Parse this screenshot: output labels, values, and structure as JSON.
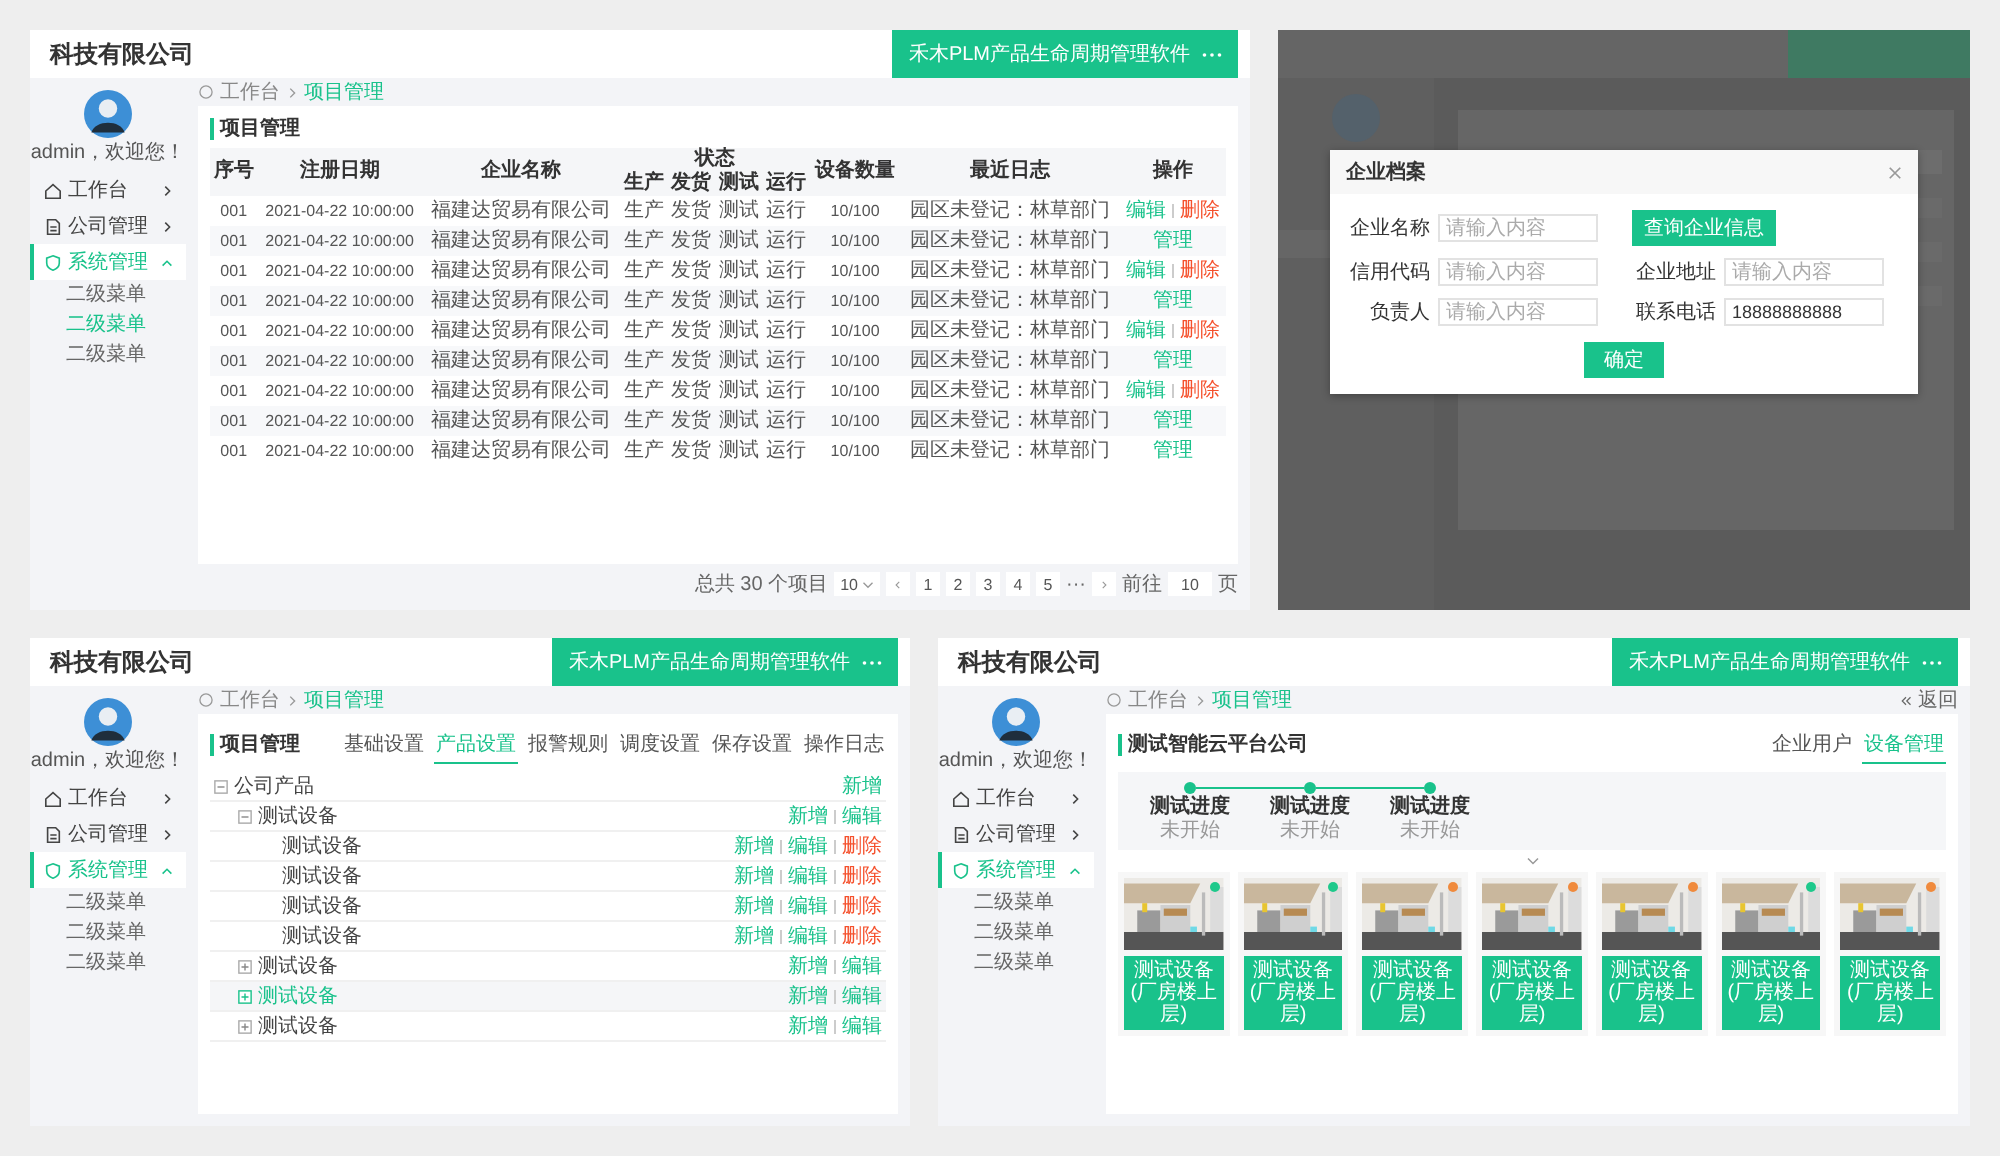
{
  "screens": [
    {
      "kind": "table",
      "app_title": "科技有限公司",
      "product_button": "禾木PLM产品生命周期管理软件",
      "sidebar": {
        "user": "admin，欢迎您！",
        "items": [
          {
            "label": "工作台",
            "selected": false,
            "expanded": false
          },
          {
            "label": "公司管理",
            "selected": false,
            "expanded": false
          },
          {
            "label": "系统管理",
            "selected": true,
            "expanded": true,
            "children": [
              {
                "label": "二级菜单",
                "selected": false
              },
              {
                "label": "二级菜单",
                "selected": true
              },
              {
                "label": "二级菜单",
                "selected": false
              }
            ]
          }
        ]
      },
      "breadcrumb": [
        "工作台",
        "项目管理"
      ],
      "card_title": "项目管理",
      "table": {
        "group_label": "状态",
        "columns": [
          {
            "label": "序号",
            "grouped": false
          },
          {
            "label": "注册日期",
            "grouped": false
          },
          {
            "label": "企业名称",
            "grouped": false
          },
          {
            "label": "生产",
            "grouped": true
          },
          {
            "label": "发货",
            "grouped": true
          },
          {
            "label": "测试",
            "grouped": true
          },
          {
            "label": "运行",
            "grouped": true
          },
          {
            "label": "设备数量",
            "grouped": false
          },
          {
            "label": "最近日志",
            "grouped": false
          },
          {
            "label": "操作",
            "grouped": false
          }
        ],
        "rows": [
          {
            "cells": [
              "001",
              "2021-04-22 10:00:00",
              "福建达贸易有限公司",
              "生产",
              "发货",
              "测试",
              "运行",
              "10/100",
              "园区未登记：林草部门"
            ],
            "actions": [
              {
                "label": "编辑",
                "danger": false
              },
              {
                "label": "删除",
                "danger": true
              }
            ]
          },
          {
            "cells": [
              "001",
              "2021-04-22 10:00:00",
              "福建达贸易有限公司",
              "生产",
              "发货",
              "测试",
              "运行",
              "10/100",
              "园区未登记：林草部门"
            ],
            "actions": [
              {
                "label": "管理",
                "danger": false
              }
            ]
          },
          {
            "cells": [
              "001",
              "2021-04-22 10:00:00",
              "福建达贸易有限公司",
              "生产",
              "发货",
              "测试",
              "运行",
              "10/100",
              "园区未登记：林草部门"
            ],
            "actions": [
              {
                "label": "编辑",
                "danger": false
              },
              {
                "label": "删除",
                "danger": true
              }
            ]
          },
          {
            "cells": [
              "001",
              "2021-04-22 10:00:00",
              "福建达贸易有限公司",
              "生产",
              "发货",
              "测试",
              "运行",
              "10/100",
              "园区未登记：林草部门"
            ],
            "actions": [
              {
                "label": "管理",
                "danger": false
              }
            ]
          },
          {
            "cells": [
              "001",
              "2021-04-22 10:00:00",
              "福建达贸易有限公司",
              "生产",
              "发货",
              "测试",
              "运行",
              "10/100",
              "园区未登记：林草部门"
            ],
            "actions": [
              {
                "label": "编辑",
                "danger": false
              },
              {
                "label": "删除",
                "danger": true
              }
            ]
          },
          {
            "cells": [
              "001",
              "2021-04-22 10:00:00",
              "福建达贸易有限公司",
              "生产",
              "发货",
              "测试",
              "运行",
              "10/100",
              "园区未登记：林草部门"
            ],
            "actions": [
              {
                "label": "管理",
                "danger": false
              }
            ]
          },
          {
            "cells": [
              "001",
              "2021-04-22 10:00:00",
              "福建达贸易有限公司",
              "生产",
              "发货",
              "测试",
              "运行",
              "10/100",
              "园区未登记：林草部门"
            ],
            "actions": [
              {
                "label": "编辑",
                "danger": false
              },
              {
                "label": "删除",
                "danger": true
              }
            ]
          },
          {
            "cells": [
              "001",
              "2021-04-22 10:00:00",
              "福建达贸易有限公司",
              "生产",
              "发货",
              "测试",
              "运行",
              "10/100",
              "园区未登记：林草部门"
            ],
            "actions": [
              {
                "label": "管理",
                "danger": false
              }
            ]
          },
          {
            "cells": [
              "001",
              "2021-04-22 10:00:00",
              "福建达贸易有限公司",
              "生产",
              "发货",
              "测试",
              "运行",
              "10/100",
              "园区未登记：林草部门"
            ],
            "actions": [
              {
                "label": "管理",
                "danger": false
              }
            ]
          }
        ]
      },
      "pagination": {
        "total": "总共 30 个项目",
        "page_size": "10",
        "pages": [
          "1",
          "2",
          "3",
          "4",
          "5"
        ],
        "ellipsis": "···",
        "goto_label": "前往",
        "goto_value": "10",
        "goto_suffix": "页"
      }
    },
    {
      "kind": "modal",
      "modal": {
        "title": "企业档案",
        "rows": [
          [
            {
              "kind": "field",
              "label": "企业名称",
              "placeholder": "请输入内容"
            },
            {
              "kind": "button",
              "label": "查询企业信息"
            }
          ],
          [
            {
              "kind": "field",
              "label": "信用代码",
              "placeholder": "请输入内容"
            },
            {
              "kind": "field",
              "label": "企业地址",
              "placeholder": "请输入内容"
            }
          ],
          [
            {
              "kind": "field",
              "label": "负责人",
              "placeholder": "请输入内容"
            },
            {
              "kind": "field",
              "label": "联系电话",
              "value": "18888888888"
            }
          ]
        ],
        "confirm": "确定"
      }
    },
    {
      "kind": "tree",
      "app_title": "科技有限公司",
      "product_button": "禾木PLM产品生命周期管理软件",
      "sidebar": {
        "user": "admin，欢迎您！",
        "items": [
          {
            "label": "工作台",
            "selected": false,
            "expanded": false
          },
          {
            "label": "公司管理",
            "selected": false,
            "expanded": false
          },
          {
            "label": "系统管理",
            "selected": true,
            "expanded": true,
            "children": [
              {
                "label": "二级菜单",
                "selected": false
              },
              {
                "label": "二级菜单",
                "selected": false
              },
              {
                "label": "二级菜单",
                "selected": false
              }
            ]
          }
        ]
      },
      "breadcrumb": [
        "工作台",
        "项目管理"
      ],
      "card_title": "项目管理",
      "tabs": [
        {
          "label": "基础设置",
          "selected": false
        },
        {
          "label": "产品设置",
          "selected": true
        },
        {
          "label": "报警规则",
          "selected": false
        },
        {
          "label": "调度设置",
          "selected": false
        },
        {
          "label": "保存设置",
          "selected": false
        },
        {
          "label": "操作日志",
          "selected": false
        }
      ],
      "tree": [
        {
          "label": "公司产品",
          "expanded": true,
          "selected": false,
          "actions": [
            {
              "label": "新增",
              "danger": false
            }
          ],
          "children": [
            {
              "label": "测试设备",
              "expanded": true,
              "selected": false,
              "actions": [
                {
                  "label": "新增",
                  "danger": false
                },
                {
                  "label": "编辑",
                  "danger": false
                }
              ],
              "children": [
                {
                  "label": "测试设备",
                  "selected": false,
                  "actions": [
                    {
                      "label": "新增",
                      "danger": false
                    },
                    {
                      "label": "编辑",
                      "danger": false
                    },
                    {
                      "label": "删除",
                      "danger": true
                    }
                  ]
                },
                {
                  "label": "测试设备",
                  "selected": false,
                  "actions": [
                    {
                      "label": "新增",
                      "danger": false
                    },
                    {
                      "label": "编辑",
                      "danger": false
                    },
                    {
                      "label": "删除",
                      "danger": true
                    }
                  ]
                },
                {
                  "label": "测试设备",
                  "selected": false,
                  "actions": [
                    {
                      "label": "新增",
                      "danger": false
                    },
                    {
                      "label": "编辑",
                      "danger": false
                    },
                    {
                      "label": "删除",
                      "danger": true
                    }
                  ]
                },
                {
                  "label": "测试设备",
                  "selected": false,
                  "actions": [
                    {
                      "label": "新增",
                      "danger": false
                    },
                    {
                      "label": "编辑",
                      "danger": false
                    },
                    {
                      "label": "删除",
                      "danger": true
                    }
                  ]
                }
              ]
            },
            {
              "label": "测试设备",
              "expanded": false,
              "selected": false,
              "actions": [
                {
                  "label": "新增",
                  "danger": false
                },
                {
                  "label": "编辑",
                  "danger": false
                }
              ]
            },
            {
              "label": "测试设备",
              "expanded": false,
              "selected": true,
              "actions": [
                {
                  "label": "新增",
                  "danger": false
                },
                {
                  "label": "编辑",
                  "danger": false
                }
              ]
            },
            {
              "label": "测试设备",
              "expanded": false,
              "selected": false,
              "actions": [
                {
                  "label": "新增",
                  "danger": false
                },
                {
                  "label": "编辑",
                  "danger": false
                }
              ]
            }
          ]
        }
      ]
    },
    {
      "kind": "cards",
      "app_title": "科技有限公司",
      "product_button": "禾木PLM产品生命周期管理软件",
      "sidebar": {
        "user": "admin，欢迎您！",
        "items": [
          {
            "label": "工作台",
            "selected": false,
            "expanded": false
          },
          {
            "label": "公司管理",
            "selected": false,
            "expanded": false
          },
          {
            "label": "系统管理",
            "selected": true,
            "expanded": true,
            "children": [
              {
                "label": "二级菜单",
                "selected": false
              },
              {
                "label": "二级菜单",
                "selected": false
              },
              {
                "label": "二级菜单",
                "selected": false
              }
            ]
          }
        ]
      },
      "breadcrumb": [
        "工作台",
        "项目管理"
      ],
      "back": "返回",
      "card_title": "测试智能云平台公司",
      "tabs": [
        {
          "label": "企业用户",
          "selected": false
        },
        {
          "label": "设备管理",
          "selected": true
        }
      ],
      "steps": [
        {
          "title": "测试进度",
          "status": "未开始"
        },
        {
          "title": "测试进度",
          "status": "未开始"
        },
        {
          "title": "测试进度",
          "status": "未开始"
        }
      ],
      "devices": [
        {
          "button": "测试设备(厂房楼上层)",
          "color": "#1ec98b"
        },
        {
          "button": "测试设备(厂房楼上层)",
          "color": "#1ec98b"
        },
        {
          "button": "测试设备(厂房楼上层)",
          "color": "#f08a3c"
        },
        {
          "button": "测试设备(厂房楼上层)",
          "color": "#f08a3c"
        },
        {
          "button": "测试设备(厂房楼上层)",
          "color": "#f08a3c"
        },
        {
          "button": "测试设备(厂房楼上层)",
          "color": "#1ec98b"
        },
        {
          "button": "测试设备(厂房楼上层)",
          "color": "#f08a3c"
        }
      ]
    }
  ]
}
